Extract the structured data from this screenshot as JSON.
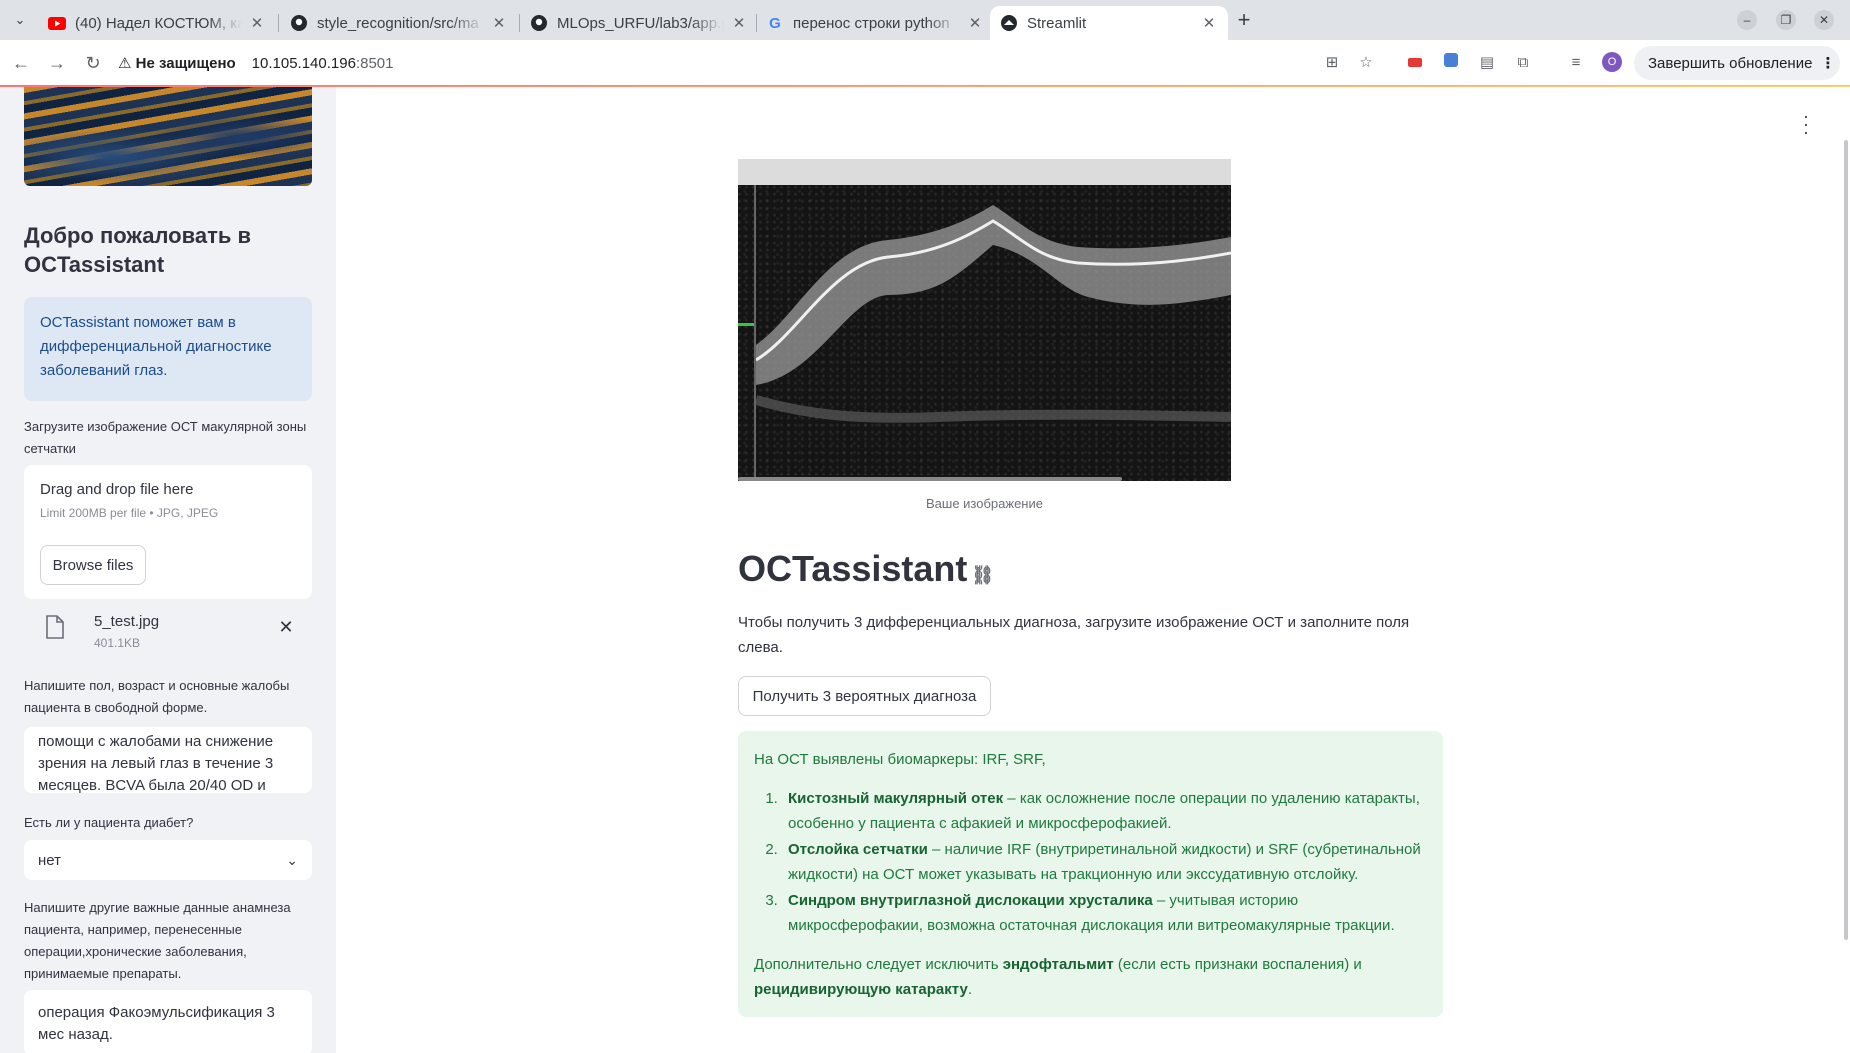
{
  "browser": {
    "tabs": [
      {
        "title": "(40) Надел КОСТЮМ, ка",
        "icon": "youtube-icon",
        "active": false
      },
      {
        "title": "style_recognition/src/ma",
        "icon": "github-icon",
        "active": false
      },
      {
        "title": "MLOps_URFU/lab3/app.p",
        "icon": "github-icon",
        "active": false
      },
      {
        "title": "перенос строки python",
        "icon": "google-icon",
        "active": false
      },
      {
        "title": "Streamlit",
        "icon": "streamlit-icon",
        "active": true
      }
    ],
    "address": {
      "security": "Не защищено",
      "host": "10.105.140.196",
      "port": ":8501"
    },
    "profile_initial": "O",
    "update_label": "Завершить обновление"
  },
  "sidebar": {
    "title": "Добро пожаловать в OCTassistant",
    "info": "OCTassistant поможет вам в дифференциальной диагностике заболеваний глаз.",
    "upload_label": "Загрузите изображение ОСТ макулярной зоны сетчатки",
    "uploader": {
      "drag_text": "Drag and drop file here",
      "limit_text": "Limit 200MB per file • JPG, JPEG",
      "browse_label": "Browse files"
    },
    "file": {
      "name": "5_test.jpg",
      "size": "401.1KB"
    },
    "complaints_label": "Напишите пол, возраст и основные жалобы пациента в свободной форме.",
    "complaints_value": "помощи с жалобами на снижение\nзрения на левый глаз в течение 3\nмесяцев. BCVA была 20/40 OD и",
    "diabetes_label": "Есть ли у пациента диабет?",
    "diabetes_value": "нет",
    "anamnesis_label": "Напишите другие важные данные анамнеза пациента, например, перенесенные операции,хронические заболевания, принимаемые препараты.",
    "anamnesis_value": "операция Факоэмульсификация 3\nмес назад."
  },
  "main": {
    "image_caption": "Ваше изображение",
    "title": "OCTassistant",
    "intro": "Чтобы получить 3 дифференциальных диагноза, загрузите изображение ОСТ и заполните поля слева.",
    "button_label": "Получить 3 вероятных диагноза",
    "result": {
      "biomarkers": "На ОСТ выявлены биомаркеры: IRF, SRF,",
      "diagnoses": [
        {
          "name": "Кистозный макулярный отек",
          "text": " – как осложнение после операции по удалению катаракты, особенно у пациента с афакией и микросферофакией."
        },
        {
          "name": "Отслойка сетчатки",
          "text": " – наличие IRF (внутриретинальной жидкости) и SRF (субретинальной жидкости) на ОСТ может указывать на тракционную или экссудативную отслойку."
        },
        {
          "name": "Синдром внутриглазной дислокации хрусталика",
          "text": " – учитывая историю микросферофакии, возможна остаточная дислокация или витреомакулярные тракции."
        }
      ],
      "extra_prefix": "Дополнительно следует исключить ",
      "extra_bold1": "эндофтальмит",
      "extra_mid": " (если есть признаки воспаления) и ",
      "extra_bold2": "рецидивирующую катаракту",
      "extra_suffix": "."
    }
  },
  "colors": {
    "info_bg": "#dde8f4",
    "info_text": "#1d4c8c",
    "success_bg": "#e8f6ec",
    "success_text": "#1f7a3d",
    "sidebar_bg": "#f0f2f6"
  }
}
